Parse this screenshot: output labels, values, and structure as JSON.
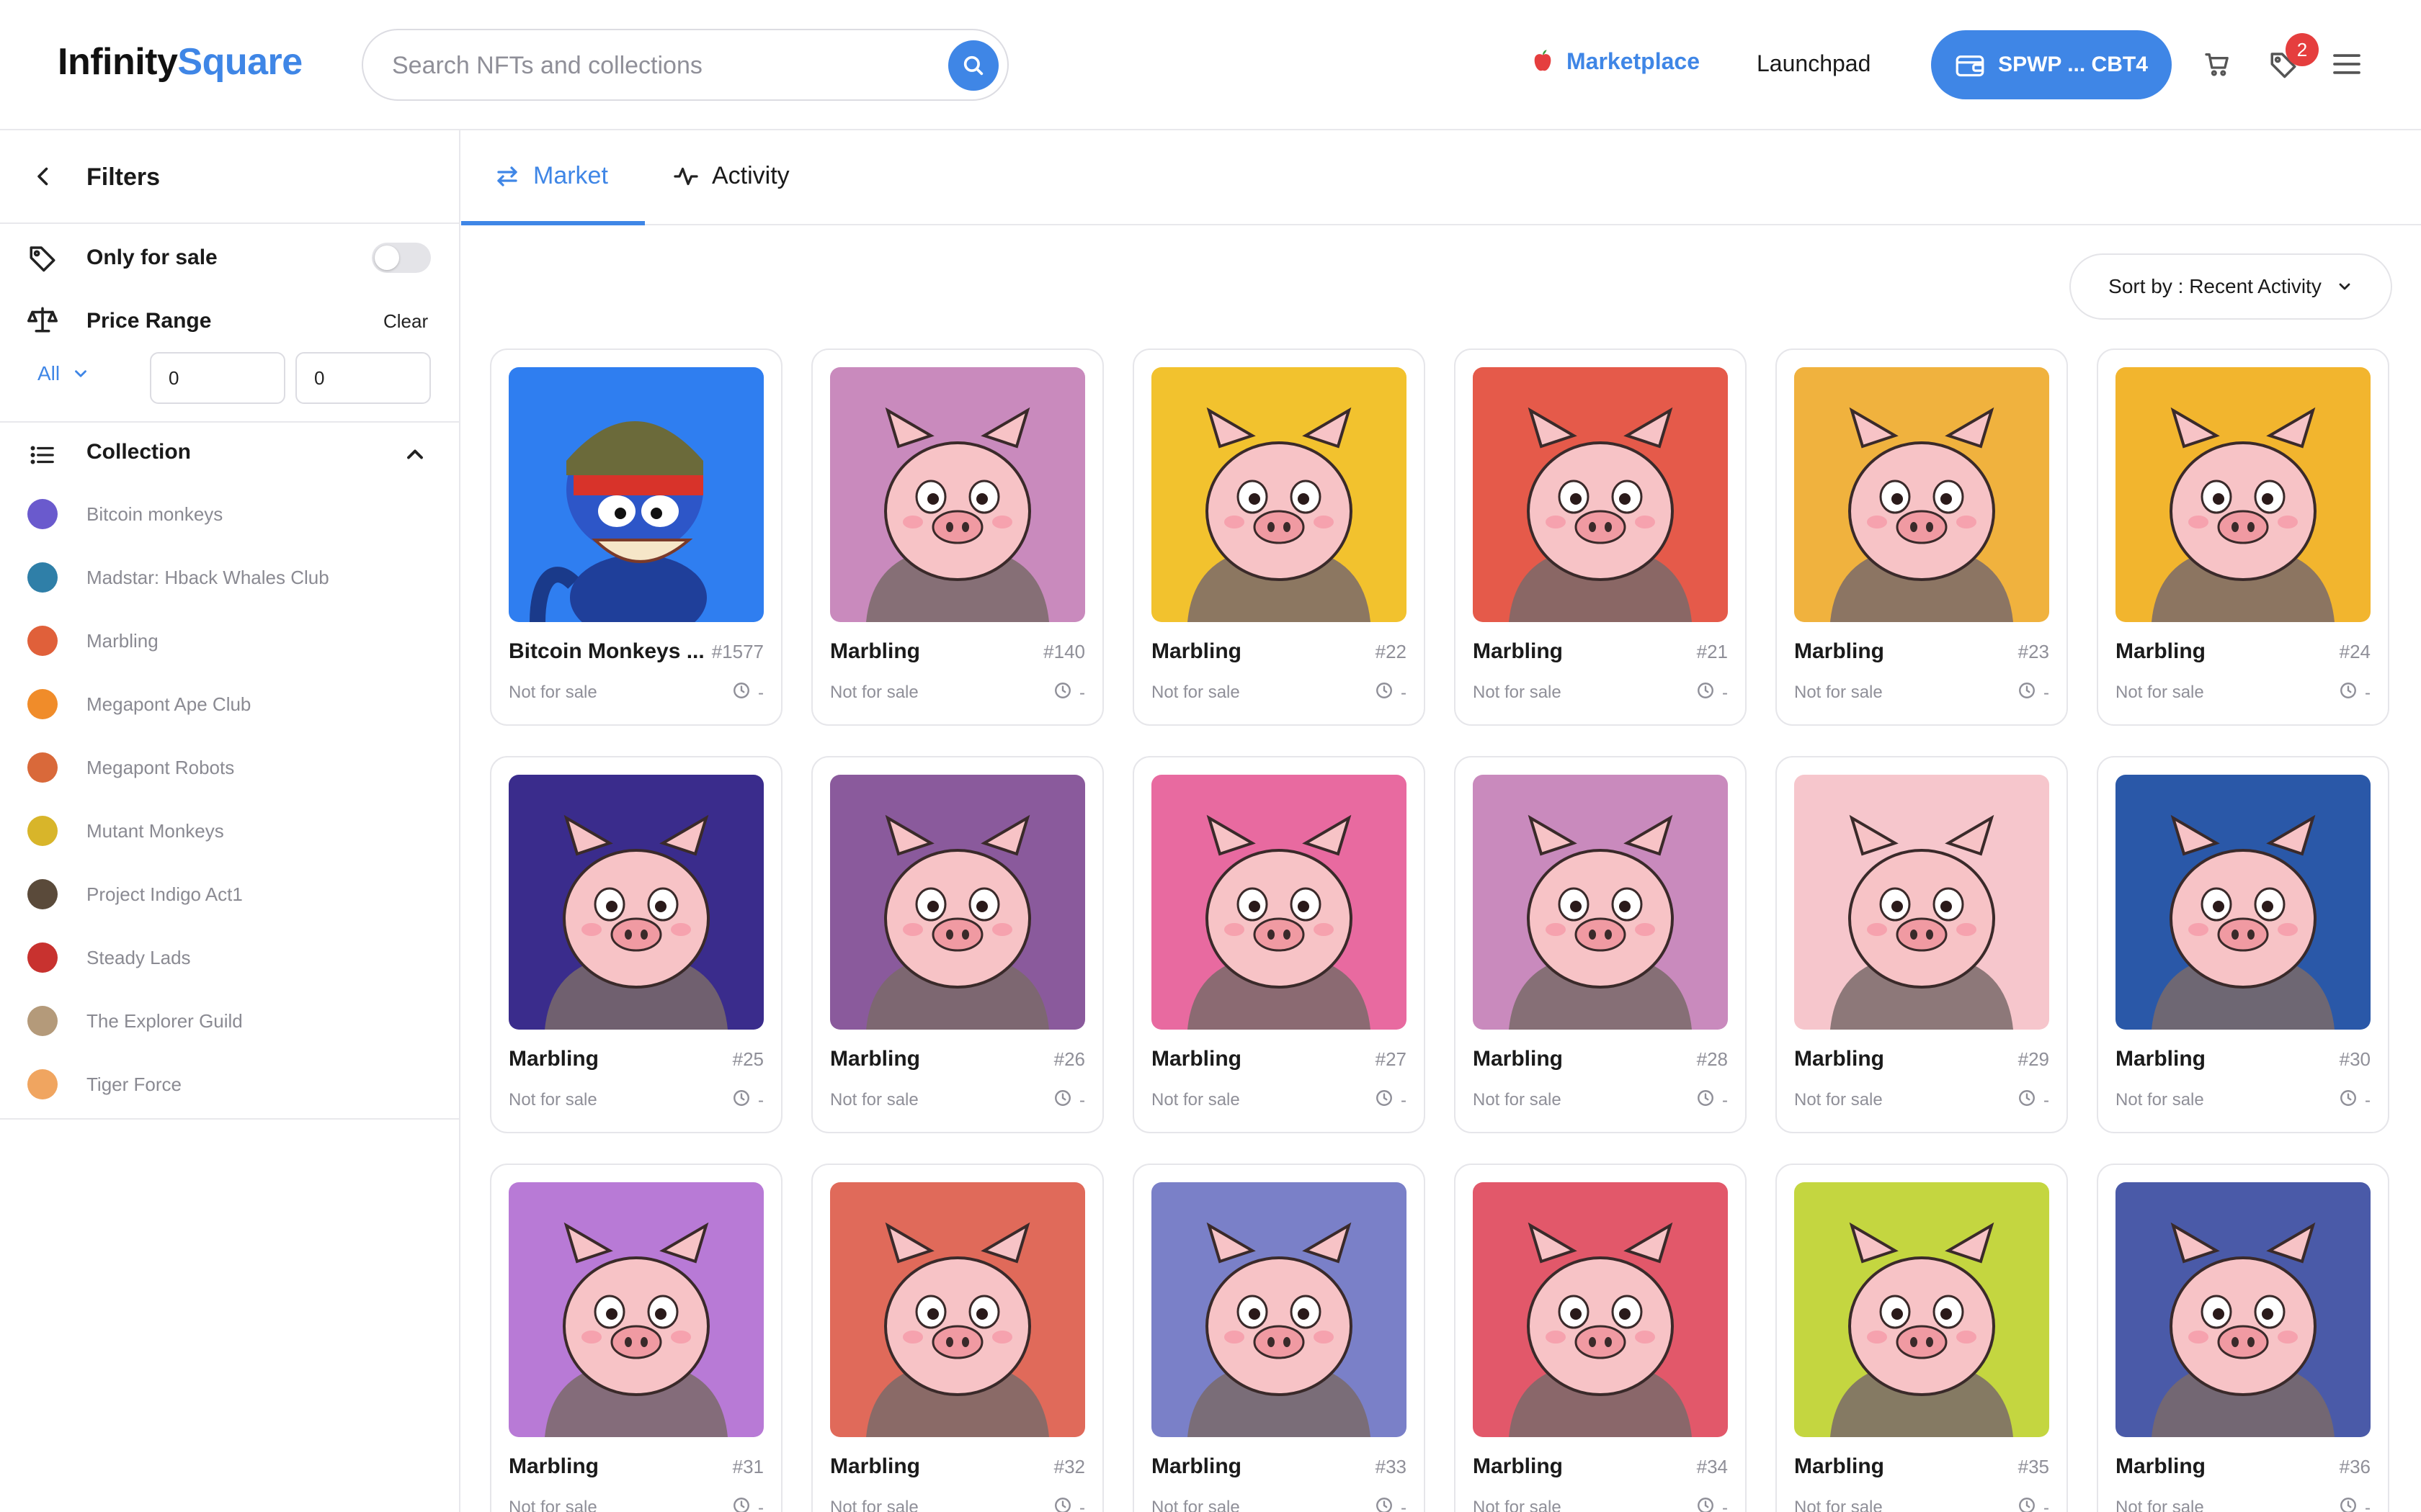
{
  "header": {
    "logo_part1": "Infinity",
    "logo_part2": "Square",
    "search_placeholder": "Search NFTs and collections",
    "nav_marketplace": "Marketplace",
    "nav_launchpad": "Launchpad",
    "wallet_label": "SPWP ... CBT4",
    "notification_count": "2",
    "accent_color": "#3f86e6"
  },
  "sidebar": {
    "title": "Filters",
    "only_for_sale": "Only for sale",
    "only_for_sale_on": false,
    "price_range": "Price Range",
    "clear": "Clear",
    "currency": "All",
    "price_min": "0",
    "price_max": "0",
    "collection_title": "Collection",
    "collections": [
      {
        "name": "Bitcoin monkeys",
        "color": "#6a5acd"
      },
      {
        "name": "Madstar: Hback Whales Club",
        "color": "#2f7fa8"
      },
      {
        "name": "Marbling",
        "color": "#e0603a"
      },
      {
        "name": "Megapont Ape Club",
        "color": "#f08c2a"
      },
      {
        "name": "Megapont Robots",
        "color": "#d9693a"
      },
      {
        "name": "Mutant Monkeys",
        "color": "#d8b52a"
      },
      {
        "name": "Project Indigo Act1",
        "color": "#5a4a3a"
      },
      {
        "name": "Steady Lads",
        "color": "#c8322f"
      },
      {
        "name": "The Explorer Guild",
        "color": "#b49a7a"
      },
      {
        "name": "Tiger Force",
        "color": "#f0a560"
      }
    ]
  },
  "tabs": {
    "market": "Market",
    "activity": "Activity"
  },
  "sort_label": "Sort by : Recent Activity",
  "cards": [
    {
      "name": "Bitcoin Monkeys ...",
      "token": "#1577",
      "status": "Not for sale",
      "time": "-",
      "bg": "#2f7ef0"
    },
    {
      "name": "Marbling",
      "token": "#140",
      "status": "Not for sale",
      "time": "-",
      "bg": "#c98abd"
    },
    {
      "name": "Marbling",
      "token": "#22",
      "status": "Not for sale",
      "time": "-",
      "bg": "#f2c22e"
    },
    {
      "name": "Marbling",
      "token": "#21",
      "status": "Not for sale",
      "time": "-",
      "bg": "#e55a4a"
    },
    {
      "name": "Marbling",
      "token": "#23",
      "status": "Not for sale",
      "time": "-",
      "bg": "#f0b23e"
    },
    {
      "name": "Marbling",
      "token": "#24",
      "status": "Not for sale",
      "time": "-",
      "bg": "#f2b52e"
    },
    {
      "name": "Marbling",
      "token": "#25",
      "status": "Not for sale",
      "time": "-",
      "bg": "#3a2c8c"
    },
    {
      "name": "Marbling",
      "token": "#26",
      "status": "Not for sale",
      "time": "-",
      "bg": "#8a5a9c"
    },
    {
      "name": "Marbling",
      "token": "#27",
      "status": "Not for sale",
      "time": "-",
      "bg": "#e86aa0"
    },
    {
      "name": "Marbling",
      "token": "#28",
      "status": "Not for sale",
      "time": "-",
      "bg": "#c98abd"
    },
    {
      "name": "Marbling",
      "token": "#29",
      "status": "Not for sale",
      "time": "-",
      "bg": "#f6c6cc"
    },
    {
      "name": "Marbling",
      "token": "#30",
      "status": "Not for sale",
      "time": "-",
      "bg": "#2a58a8"
    },
    {
      "name": "Marbling",
      "token": "#31",
      "status": "Not for sale",
      "time": "-",
      "bg": "#b87ad6"
    },
    {
      "name": "Marbling",
      "token": "#32",
      "status": "Not for sale",
      "time": "-",
      "bg": "#e06a5a"
    },
    {
      "name": "Marbling",
      "token": "#33",
      "status": "Not for sale",
      "time": "-",
      "bg": "#7a80c8"
    },
    {
      "name": "Marbling",
      "token": "#34",
      "status": "Not for sale",
      "time": "-",
      "bg": "#e2586a"
    },
    {
      "name": "Marbling",
      "token": "#35",
      "status": "Not for sale",
      "time": "-",
      "bg": "#c4d640"
    },
    {
      "name": "Marbling",
      "token": "#36",
      "status": "Not for sale",
      "time": "-",
      "bg": "#4a5aa8"
    }
  ]
}
